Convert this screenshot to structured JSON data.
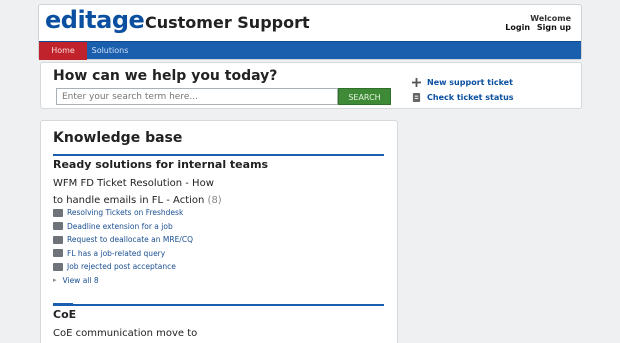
{
  "header": {
    "logo": "editage",
    "portal_title": "Customer Support",
    "welcome": "Welcome",
    "login": "Login",
    "signup": "Sign up"
  },
  "nav": {
    "tabs": [
      {
        "label": "Home"
      },
      {
        "label": "Solutions"
      }
    ]
  },
  "search": {
    "heading": "How can we help you today?",
    "placeholder": "Enter your search term here...",
    "button": "SEARCH"
  },
  "quick_links": [
    {
      "label": "New support ticket",
      "icon": "plus-icon"
    },
    {
      "label": "Check ticket status",
      "icon": "ticket-icon"
    }
  ],
  "knowledge_base": {
    "title": "Knowledge base",
    "categories": [
      {
        "title": "Ready solutions for internal teams",
        "folder": "WFM FD Ticket Resolution - How to handle emails in FL - Action",
        "folder_count": "(8)",
        "articles": [
          "Resolving Tickets on Freshdesk",
          "Deadline extension for a job",
          "Request to deallocate an MRE/CQ",
          "FL has a job-related query",
          "Job rejected post acceptance"
        ],
        "view_all": "View all 8"
      },
      {
        "title": "CoE",
        "folder": "CoE communication move to"
      }
    ]
  },
  "colors": {
    "brand_blue": "#1a5fae",
    "active_tab_red": "#c0232b",
    "search_green": "#3f8a37"
  }
}
